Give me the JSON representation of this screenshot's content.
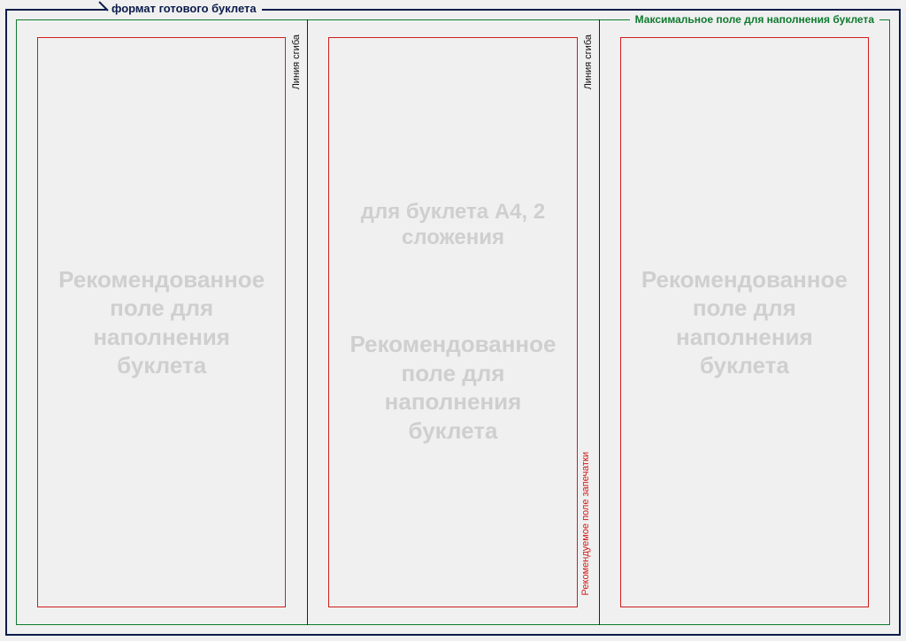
{
  "labels": {
    "format_border": "формат готового буклета",
    "fill_border": "Максимальное поле для наполнения буклета",
    "fold_line": "Линия сгиба",
    "print_area": "Рекомендуемое поле запечатки"
  },
  "panels": [
    {
      "subtitle": "",
      "watermark": "Рекомендованное поле для наполнения буклета"
    },
    {
      "subtitle": "для буклета А4, 2 сложения",
      "watermark": "Рекомендованное поле для наполнения буклета"
    },
    {
      "subtitle": "",
      "watermark": "Рекомендованное поле для наполнения буклета"
    }
  ],
  "colors": {
    "format_border": "#0a1c4a",
    "fill_border": "#0e7a2e",
    "content_border": "#d11c1c",
    "watermark_text": "#cfcfcf"
  },
  "layout": {
    "panel_count": 3,
    "fold_count": 2,
    "page_format": "A4"
  }
}
